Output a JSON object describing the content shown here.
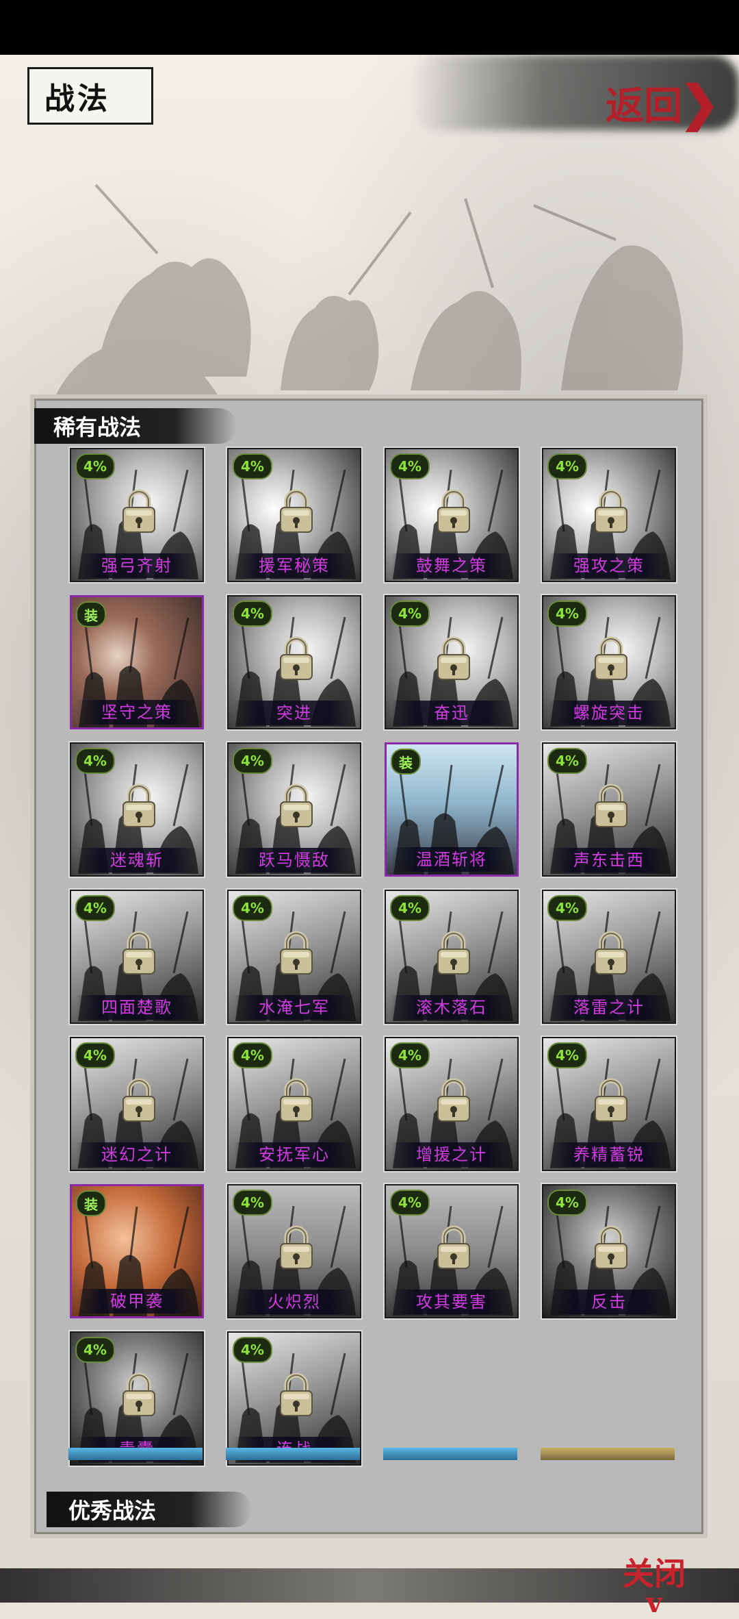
{
  "header": {
    "title": "战法",
    "back_label": "返回",
    "back_chevron": "❯"
  },
  "sections": [
    {
      "title": "稀有战法",
      "tiles": [
        {
          "name": "强弓齐射",
          "badge": "4%",
          "equipped": false,
          "locked": true,
          "art": "bw-riders"
        },
        {
          "name": "援军秘策",
          "badge": "4%",
          "equipped": false,
          "locked": true,
          "art": "bw-general"
        },
        {
          "name": "鼓舞之策",
          "badge": "4%",
          "equipped": false,
          "locked": true,
          "art": "bw-general"
        },
        {
          "name": "强攻之策",
          "badge": "4%",
          "equipped": false,
          "locked": true,
          "art": "bw-general"
        },
        {
          "name": "坚守之策",
          "badge": "装",
          "equipped": true,
          "locked": false,
          "art": "brown-general"
        },
        {
          "name": "突进",
          "badge": "4%",
          "equipped": false,
          "locked": true,
          "art": "bw-riders"
        },
        {
          "name": "奋迅",
          "badge": "4%",
          "equipped": false,
          "locked": true,
          "art": "bw-riders"
        },
        {
          "name": "螺旋突击",
          "badge": "4%",
          "equipped": false,
          "locked": true,
          "art": "bw-riders"
        },
        {
          "name": "迷魂斩",
          "badge": "4%",
          "equipped": false,
          "locked": true,
          "art": "bw-riders"
        },
        {
          "name": "跃马慑敌",
          "badge": "4%",
          "equipped": false,
          "locked": true,
          "art": "bw-riders"
        },
        {
          "name": "温酒斩将",
          "badge": "装",
          "equipped": true,
          "locked": false,
          "art": "blue-riders"
        },
        {
          "name": "声东击西",
          "badge": "4%",
          "equipped": false,
          "locked": true,
          "art": "bw-crowd"
        },
        {
          "name": "四面楚歌",
          "badge": "4%",
          "equipped": false,
          "locked": true,
          "art": "bw-crowd"
        },
        {
          "name": "水淹七军",
          "badge": "4%",
          "equipped": false,
          "locked": true,
          "art": "bw-crowd"
        },
        {
          "name": "滚木落石",
          "badge": "4%",
          "equipped": false,
          "locked": true,
          "art": "bw-crowd"
        },
        {
          "name": "落雷之计",
          "badge": "4%",
          "equipped": false,
          "locked": true,
          "art": "bw-crowd"
        },
        {
          "name": "迷幻之计",
          "badge": "4%",
          "equipped": false,
          "locked": true,
          "art": "bw-crowd"
        },
        {
          "name": "安抚军心",
          "badge": "4%",
          "equipped": false,
          "locked": true,
          "art": "bw-crowd"
        },
        {
          "name": "增援之计",
          "badge": "4%",
          "equipped": false,
          "locked": true,
          "art": "bw-crowd"
        },
        {
          "name": "养精蓄锐",
          "badge": "4%",
          "equipped": false,
          "locked": true,
          "art": "bw-crowd"
        },
        {
          "name": "破甲袭",
          "badge": "装",
          "equipped": true,
          "locked": false,
          "art": "orange-spears"
        },
        {
          "name": "火炽烈",
          "badge": "4%",
          "equipped": false,
          "locked": true,
          "art": "bw-spears"
        },
        {
          "name": "攻其要害",
          "badge": "4%",
          "equipped": false,
          "locked": true,
          "art": "bw-spears"
        },
        {
          "name": "反击",
          "badge": "4%",
          "equipped": false,
          "locked": true,
          "art": "bw-warrior"
        },
        {
          "name": "青囊",
          "badge": "4%",
          "equipped": false,
          "locked": true,
          "art": "bw-warrior"
        },
        {
          "name": "连战",
          "badge": "4%",
          "equipped": false,
          "locked": true,
          "art": "bw-crowd"
        }
      ]
    },
    {
      "title": "优秀战法",
      "tiles": []
    }
  ],
  "footer": {
    "close_label": "关闭",
    "close_chevron": "v"
  },
  "colors": {
    "label_text": "#d13be0",
    "badge_text": "#8ee23a",
    "equipped_border": "#8a2aa8",
    "back_red": "#b3202a"
  }
}
